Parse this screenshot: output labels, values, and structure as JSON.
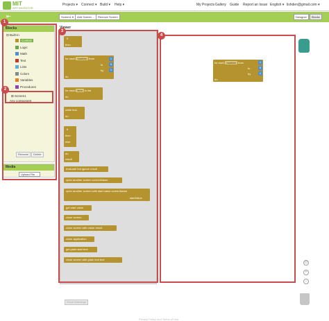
{
  "app": {
    "logo_mit": "MIT",
    "logo_sub": "APP INVENTOR"
  },
  "nav": {
    "projects": "Projects ▾",
    "connect": "Connect ▾",
    "build": "Build ▾",
    "help": "Help ▾",
    "my_projects": "My Projects",
    "gallery": "Gallery",
    "guide": "Guide",
    "report": "Report an Issue",
    "language": "English ▾",
    "user": "lishden@gmail.com ▾"
  },
  "toolbar": {
    "screen_select": "Screen1 ▾",
    "add_screen": "Add Screen ...",
    "remove_screen": "Remove Screen",
    "designer": "Designer",
    "blocks": "Blocks"
  },
  "blocks_panel": {
    "title": "Blocks",
    "builtin": "Built-in",
    "items": [
      {
        "label": "Control",
        "color": "#b5932f"
      },
      {
        "label": "Logic",
        "color": "#6aa84f"
      },
      {
        "label": "Math",
        "color": "#4f8ed1"
      },
      {
        "label": "Text",
        "color": "#c0392b"
      },
      {
        "label": "Lists",
        "color": "#5dade2"
      },
      {
        "label": "Colors",
        "color": "#7f8c8d"
      },
      {
        "label": "Variables",
        "color": "#e67e22"
      },
      {
        "label": "Procedures",
        "color": "#8e44ad"
      }
    ],
    "screen1": "Screen1",
    "any_component": "Any component",
    "rename": "Rename",
    "delete": "Delete"
  },
  "media_panel": {
    "title": "Media",
    "upload": "Upload File ..."
  },
  "viewer": {
    "title": "Viewer",
    "show_warnings": "Show Warnings"
  },
  "flyout_blocks": {
    "if": "if",
    "then": "then",
    "for_each": "for each",
    "number": "number",
    "from": "from",
    "to": "to",
    "by": "by",
    "do": "do",
    "item": "item",
    "in_list": "in list",
    "while": "while",
    "test": "test",
    "else": "else",
    "result": "result",
    "evaluate": "evaluate but ignore result",
    "open_screen": "open another screen  screenName",
    "open_screen_value": "open another screen with start value  screenName",
    "start_value": "startValue",
    "get_start_value": "get start value",
    "close_screen": "close screen",
    "close_screen_value": "close screen with value  result",
    "close_app": "close application",
    "get_plain": "get plain start text",
    "close_plain": "close screen with plain text  text",
    "one": "1",
    "five": "5"
  },
  "workspace_block": {
    "for_each": "for each",
    "number": "number",
    "from": "from",
    "to": "to",
    "by": "by",
    "do": "do",
    "from_val": "1",
    "to_val": "5",
    "by_val": "1"
  },
  "annotations": {
    "one": "1",
    "two": "2",
    "three": "3",
    "four": "4"
  },
  "zoom": {
    "plus": "+",
    "minus": "−",
    "center": "⊙"
  },
  "footer": "Privacy Policy and Terms of Use",
  "colors": {
    "accent": "#a5cf54",
    "annotation": "#c94b4b",
    "control_block": "#b5932f"
  }
}
